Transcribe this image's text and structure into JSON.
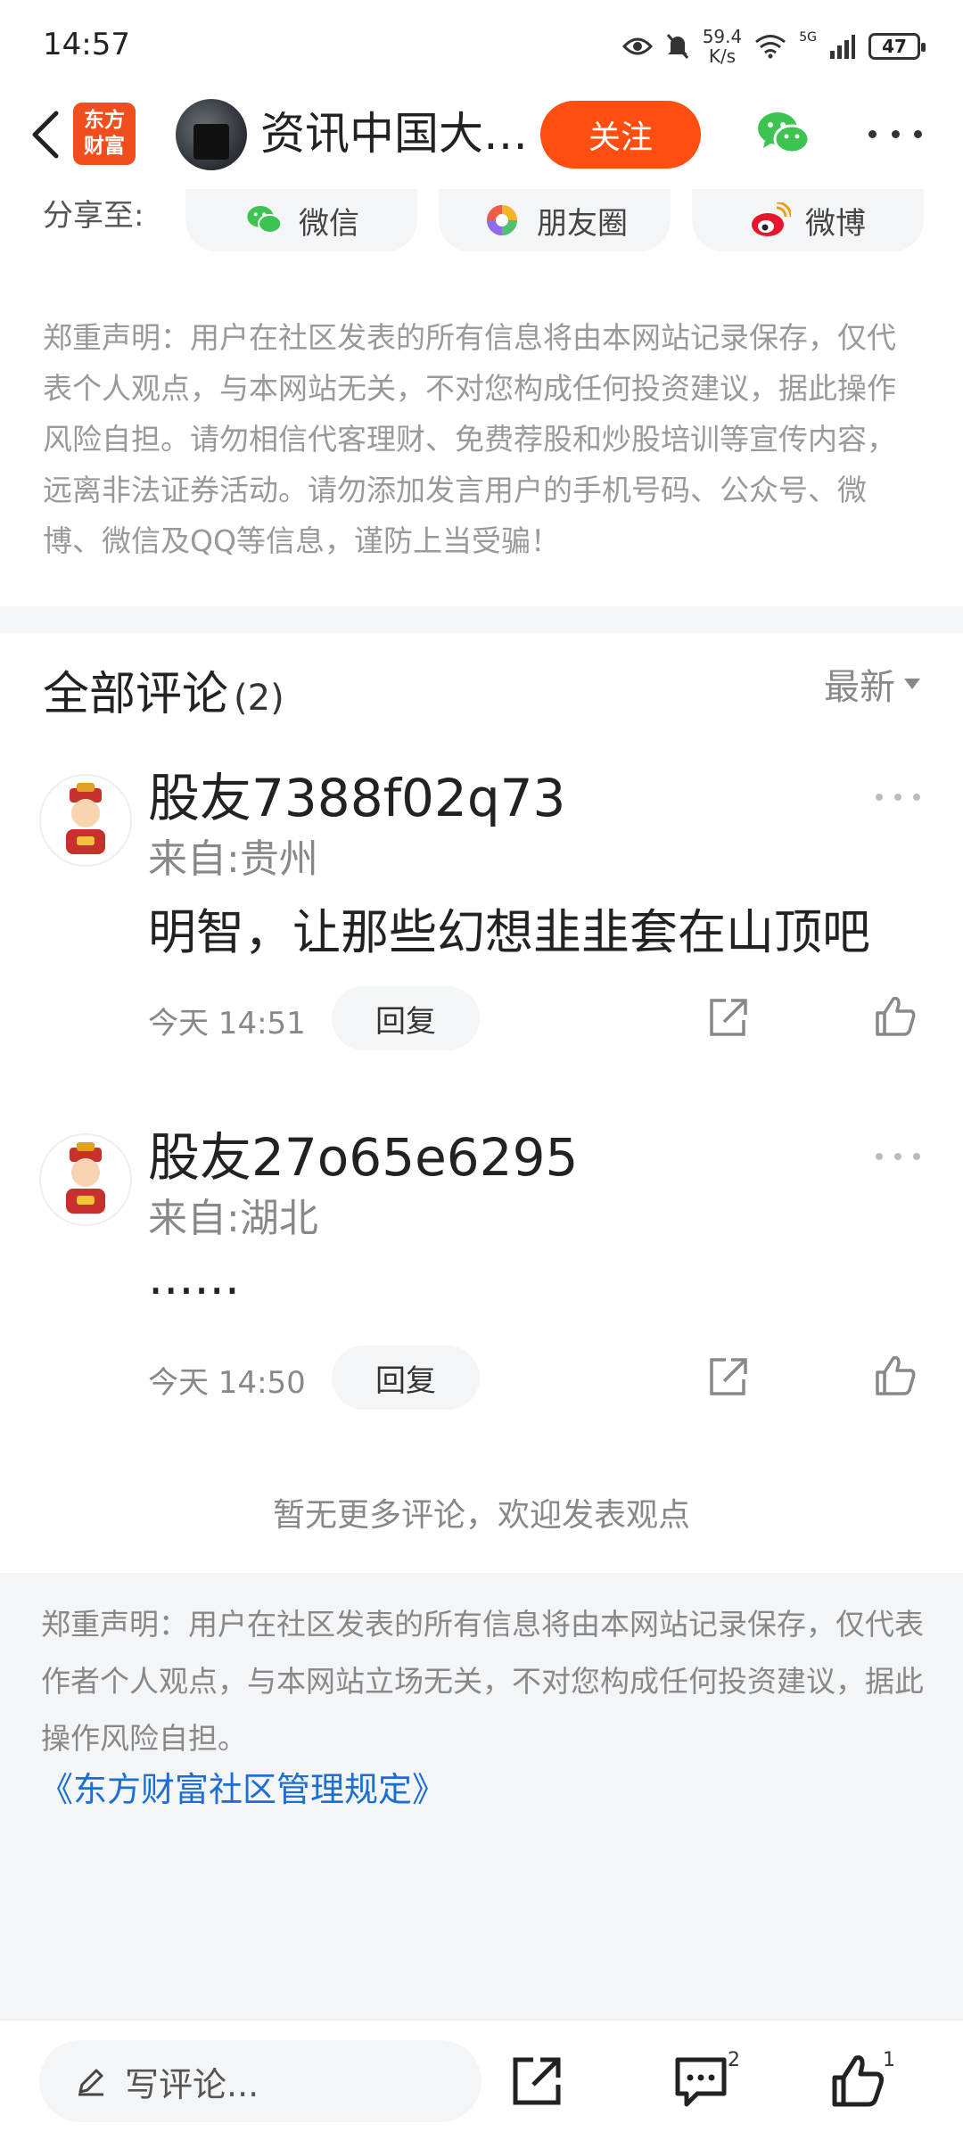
{
  "status_bar": {
    "time": "14:57",
    "net_speed_value": "59.4",
    "net_speed_unit": "K/s",
    "network": "5G",
    "battery": "47"
  },
  "header": {
    "logo_line1": "东方",
    "logo_line2": "财富",
    "author_name": "资讯中国大…",
    "follow_label": "关注"
  },
  "share": {
    "label": "分享至:",
    "options": [
      {
        "label": "微信",
        "icon": "wechat-icon"
      },
      {
        "label": "朋友圈",
        "icon": "moments-icon"
      },
      {
        "label": "微博",
        "icon": "weibo-icon"
      }
    ]
  },
  "disclaimer_top": "郑重声明：用户在社区发表的所有信息将由本网站记录保存，仅代表个人观点，与本网站无关，不对您构成任何投资建议，据此操作风险自担。请勿相信代客理财、免费荐股和炒股培训等宣传内容，远离非法证券活动。请勿添加发言用户的手机号码、公众号、微博、微信及QQ等信息，谨防上当受骗！",
  "comments_section": {
    "title": "全部评论",
    "count": "(2)",
    "sort_label": "最新"
  },
  "comments": [
    {
      "user": "股友7388f02q73",
      "location": "来自:贵州",
      "text": "明智，让那些幻想韭韭套在山顶吧",
      "time": "今天 14:51",
      "reply_label": "回复"
    },
    {
      "user": "股友27o65e6295",
      "location": "来自:湖北",
      "text": "......",
      "time": "今天 14:50",
      "reply_label": "回复"
    }
  ],
  "no_more_text": "暂无更多评论，欢迎发表观点",
  "disclaimer_bottom": "郑重声明：用户在社区发表的所有信息将由本网站记录保存，仅代表作者个人观点，与本网站立场无关，不对您构成任何投资建议，据此操作风险自担。",
  "rules_link": "《东方财富社区管理规定》",
  "bottom_bar": {
    "input_placeholder": "写评论...",
    "comment_count": "2",
    "like_count": "1"
  },
  "colors": {
    "accent": "#ff4e10",
    "link": "#1a6fd1",
    "wechat": "#3cc350",
    "weibo": "#e6162d"
  }
}
